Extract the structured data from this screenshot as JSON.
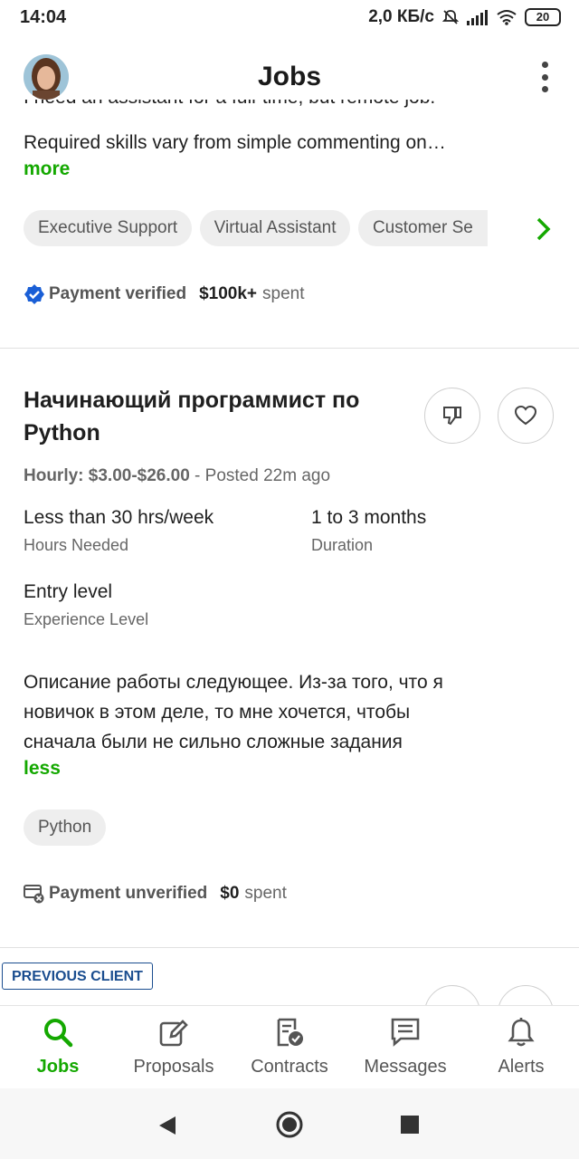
{
  "status_bar": {
    "time": "14:04",
    "speed": "2,0 КБ/с",
    "battery": "20"
  },
  "header": {
    "title": "Jobs"
  },
  "job_prev": {
    "desc_partial_top": "I need an assistant for a full-time, but remote job.",
    "desc_partial": "Required skills vary from simple commenting on…",
    "more": "more",
    "skills": [
      "Executive Support",
      "Virtual Assistant",
      "Customer Se"
    ],
    "payment_status": "Payment verified",
    "spent_amount": "$100k+",
    "spent_label": "spent"
  },
  "job_main": {
    "title_line1": "Начинающий программист по",
    "title_line2": "Python",
    "rate_label": "Hourly: $3.00-$26.00",
    "posted": " - Posted 22m ago",
    "hours_value": "Less than 30 hrs/week",
    "hours_label": "Hours Needed",
    "duration_value": "1 to 3 months",
    "duration_label": "Duration",
    "level_value": "Entry level",
    "level_label": "Experience Level",
    "desc_line1": "Описание работы следующее. Из-за того, что я",
    "desc_line2": "новичок в этом деле, то мне хочется, чтобы",
    "desc_line3": "сначала были не сильно сложные задания",
    "less": "less",
    "skills": [
      "Python"
    ],
    "payment_status": "Payment unverified",
    "spent_amount": "$0",
    "spent_label": "spent"
  },
  "job_next": {
    "badge": "PREVIOUS CLIENT"
  },
  "bottom_nav": {
    "items": [
      {
        "label": "Jobs",
        "icon": "search-icon",
        "active": true
      },
      {
        "label": "Proposals",
        "icon": "edit-icon",
        "active": false
      },
      {
        "label": "Contracts",
        "icon": "contract-icon",
        "active": false
      },
      {
        "label": "Messages",
        "icon": "message-icon",
        "active": false
      },
      {
        "label": "Alerts",
        "icon": "bell-icon",
        "active": false
      }
    ]
  },
  "colors": {
    "accent": "#14a800",
    "verified_blue": "#1a5fd6",
    "badge_blue": "#1a4d8f"
  }
}
